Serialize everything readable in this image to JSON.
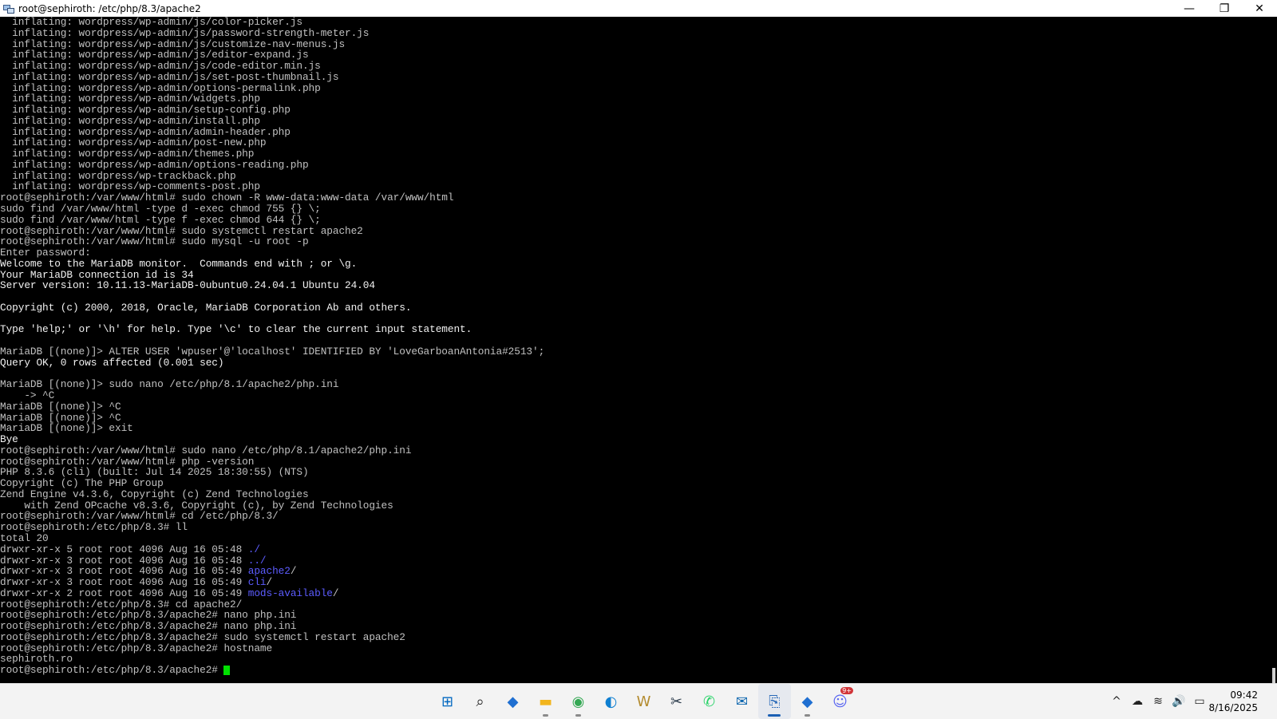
{
  "window": {
    "title": "root@sephiroth: /etc/php/8.3/apache2",
    "minimize": "—",
    "restore": "❐",
    "close": "✕"
  },
  "terminal_lines": [
    {
      "text": "  inflating: wordpress/wp-admin/js/color-picker.js"
    },
    {
      "text": "  inflating: wordpress/wp-admin/js/password-strength-meter.js"
    },
    {
      "text": "  inflating: wordpress/wp-admin/js/customize-nav-menus.js"
    },
    {
      "text": "  inflating: wordpress/wp-admin/js/editor-expand.js"
    },
    {
      "text": "  inflating: wordpress/wp-admin/js/code-editor.min.js"
    },
    {
      "text": "  inflating: wordpress/wp-admin/js/set-post-thumbnail.js"
    },
    {
      "text": "  inflating: wordpress/wp-admin/options-permalink.php"
    },
    {
      "text": "  inflating: wordpress/wp-admin/widgets.php"
    },
    {
      "text": "  inflating: wordpress/wp-admin/setup-config.php"
    },
    {
      "text": "  inflating: wordpress/wp-admin/install.php"
    },
    {
      "text": "  inflating: wordpress/wp-admin/admin-header.php"
    },
    {
      "text": "  inflating: wordpress/wp-admin/post-new.php"
    },
    {
      "text": "  inflating: wordpress/wp-admin/themes.php"
    },
    {
      "text": "  inflating: wordpress/wp-admin/options-reading.php"
    },
    {
      "text": "  inflating: wordpress/wp-trackback.php"
    },
    {
      "text": "  inflating: wordpress/wp-comments-post.php"
    },
    {
      "text": "root@sephiroth:/var/www/html# sudo chown -R www-data:www-data /var/www/html"
    },
    {
      "text": "sudo find /var/www/html -type d -exec chmod 755 {} \\;"
    },
    {
      "text": "sudo find /var/www/html -type f -exec chmod 644 {} \\;"
    },
    {
      "text": "root@sephiroth:/var/www/html# sudo systemctl restart apache2"
    },
    {
      "text": "root@sephiroth:/var/www/html# sudo mysql -u root -p"
    },
    {
      "text": "Enter password:"
    },
    {
      "text": "Welcome to the MariaDB monitor.  Commands end with ; or \\g.",
      "bright": true
    },
    {
      "text": "Your MariaDB connection id is 34",
      "bright": true
    },
    {
      "text": "Server version: 10.11.13-MariaDB-0ubuntu0.24.04.1 Ubuntu 24.04",
      "bright": true
    },
    {
      "text": ""
    },
    {
      "text": "Copyright (c) 2000, 2018, Oracle, MariaDB Corporation Ab and others.",
      "bright": true
    },
    {
      "text": ""
    },
    {
      "text": "Type 'help;' or '\\h' for help. Type '\\c' to clear the current input statement.",
      "bright": true
    },
    {
      "text": ""
    },
    {
      "text": "MariaDB [(none)]> ALTER USER 'wpuser'@'localhost' IDENTIFIED BY 'LoveGarboanAntonia#2513';"
    },
    {
      "text": "Query OK, 0 rows affected (0.001 sec)",
      "bright": true
    },
    {
      "text": ""
    },
    {
      "text": "MariaDB [(none)]> sudo nano /etc/php/8.1/apache2/php.ini"
    },
    {
      "text": "    -> ^C"
    },
    {
      "text": "MariaDB [(none)]> ^C"
    },
    {
      "text": "MariaDB [(none)]> ^C"
    },
    {
      "text": "MariaDB [(none)]> exit"
    },
    {
      "text": "Bye",
      "bright": true
    },
    {
      "text": "root@sephiroth:/var/www/html# sudo nano /etc/php/8.1/apache2/php.ini"
    },
    {
      "text": "root@sephiroth:/var/www/html# php -version"
    },
    {
      "text": "PHP 8.3.6 (cli) (built: Jul 14 2025 18:30:55) (NTS)"
    },
    {
      "text": "Copyright (c) The PHP Group"
    },
    {
      "text": "Zend Engine v4.3.6, Copyright (c) Zend Technologies"
    },
    {
      "text": "    with Zend OPcache v8.3.6, Copyright (c), by Zend Technologies"
    },
    {
      "text": "root@sephiroth:/var/www/html# cd /etc/php/8.3/"
    },
    {
      "text": "root@sephiroth:/etc/php/8.3# ll"
    },
    {
      "text": "total 20"
    },
    {
      "text": "drwxr-xr-x 5 root root 4096 Aug 16 05:48 ",
      "dir": "./"
    },
    {
      "text": "drwxr-xr-x 3 root root 4096 Aug 16 05:48 ",
      "dir": "../"
    },
    {
      "text": "drwxr-xr-x 3 root root 4096 Aug 16 05:49 ",
      "dir": "apache2",
      "suffix": "/"
    },
    {
      "text": "drwxr-xr-x 3 root root 4096 Aug 16 05:49 ",
      "dir": "cli",
      "suffix": "/"
    },
    {
      "text": "drwxr-xr-x 2 root root 4096 Aug 16 05:49 ",
      "dir": "mods-available",
      "suffix": "/"
    },
    {
      "text": "root@sephiroth:/etc/php/8.3# cd apache2/"
    },
    {
      "text": "root@sephiroth:/etc/php/8.3/apache2# nano php.ini"
    },
    {
      "text": "root@sephiroth:/etc/php/8.3/apache2# nano php.ini"
    },
    {
      "text": "root@sephiroth:/etc/php/8.3/apache2# sudo systemctl restart apache2"
    },
    {
      "text": "root@sephiroth:/etc/php/8.3/apache2# hostname"
    },
    {
      "text": "sephiroth.ro"
    },
    {
      "text": "root@sephiroth:/etc/php/8.3/apache2# ",
      "cursor": true
    }
  ],
  "colors": {
    "terminal_bg": "#000000",
    "terminal_text": "#c0c0c0",
    "directory": "#5c5cff",
    "cursor": "#00e000"
  },
  "taskbar": {
    "apps": [
      {
        "name": "start-icon",
        "glyph": "⊞",
        "color": "#0067c0"
      },
      {
        "name": "search-icon",
        "glyph": "⌕",
        "color": "#222222"
      },
      {
        "name": "remote-desktop-icon",
        "glyph": "◆",
        "color": "#1f6fd1"
      },
      {
        "name": "file-explorer-icon",
        "glyph": "▬",
        "color": "#f2b51d",
        "running": true
      },
      {
        "name": "chrome-icon",
        "glyph": "◉",
        "color": "#34a853",
        "running": true
      },
      {
        "name": "edge-icon",
        "glyph": "◐",
        "color": "#0f7fd1"
      },
      {
        "name": "word-icon",
        "glyph": "W",
        "color": "#b38b2e"
      },
      {
        "name": "snipping-tool-icon",
        "glyph": "✂",
        "color": "#2a3a4a"
      },
      {
        "name": "whatsapp-icon",
        "glyph": "✆",
        "color": "#25d366"
      },
      {
        "name": "outlook-icon",
        "glyph": "✉",
        "color": "#0a64ad"
      },
      {
        "name": "network-tool-icon",
        "glyph": "⎘",
        "color": "#2a6ab8",
        "running": true,
        "active": true
      },
      {
        "name": "remote-app-icon",
        "glyph": "◆",
        "color": "#1f6fd1",
        "running": true
      },
      {
        "name": "discord-icon",
        "glyph": "☺",
        "color": "#5865f2",
        "badge": "9+"
      }
    ],
    "tray": {
      "chevron": "^",
      "onedrive": "☁",
      "wifi": "≋",
      "volume": "🔊",
      "battery": "▭"
    },
    "time": "09:42",
    "date": "8/16/2025"
  }
}
